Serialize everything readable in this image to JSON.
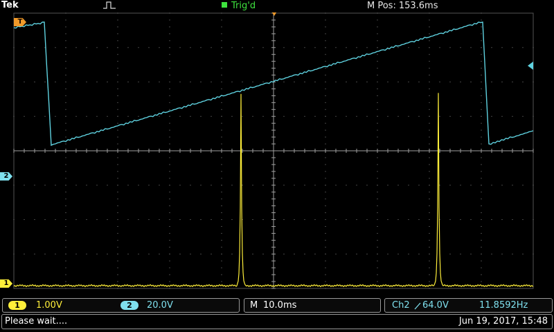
{
  "header": {
    "brand": "Tek",
    "trigger_status": "Trig'd",
    "horizontal_position_label": "M Pos:",
    "horizontal_position_value": "153.6ms"
  },
  "channels": {
    "ch1": {
      "label": "1",
      "scale": "1.00V",
      "color": "#ffef3a"
    },
    "ch2": {
      "label": "2",
      "scale": "20.0V",
      "color": "#7fe0ee"
    },
    "trigger_marker_label": "T"
  },
  "timebase": {
    "label": "M",
    "value": "10.0ms"
  },
  "trigger_info": {
    "source": "Ch2",
    "slope_icon": "rising-edge-icon",
    "level": "64.0V",
    "frequency": "11.8592Hz"
  },
  "status": {
    "message": "Please wait....",
    "datetime": "Jun 19, 2017, 15:48"
  },
  "colors": {
    "grid": "#6a6a6a",
    "trace_ch1": "#ffef3a",
    "trace_ch2": "#5fd2e0",
    "trigger_status": "#3ee23e",
    "trigger_marker": "#f09a2a"
  }
}
